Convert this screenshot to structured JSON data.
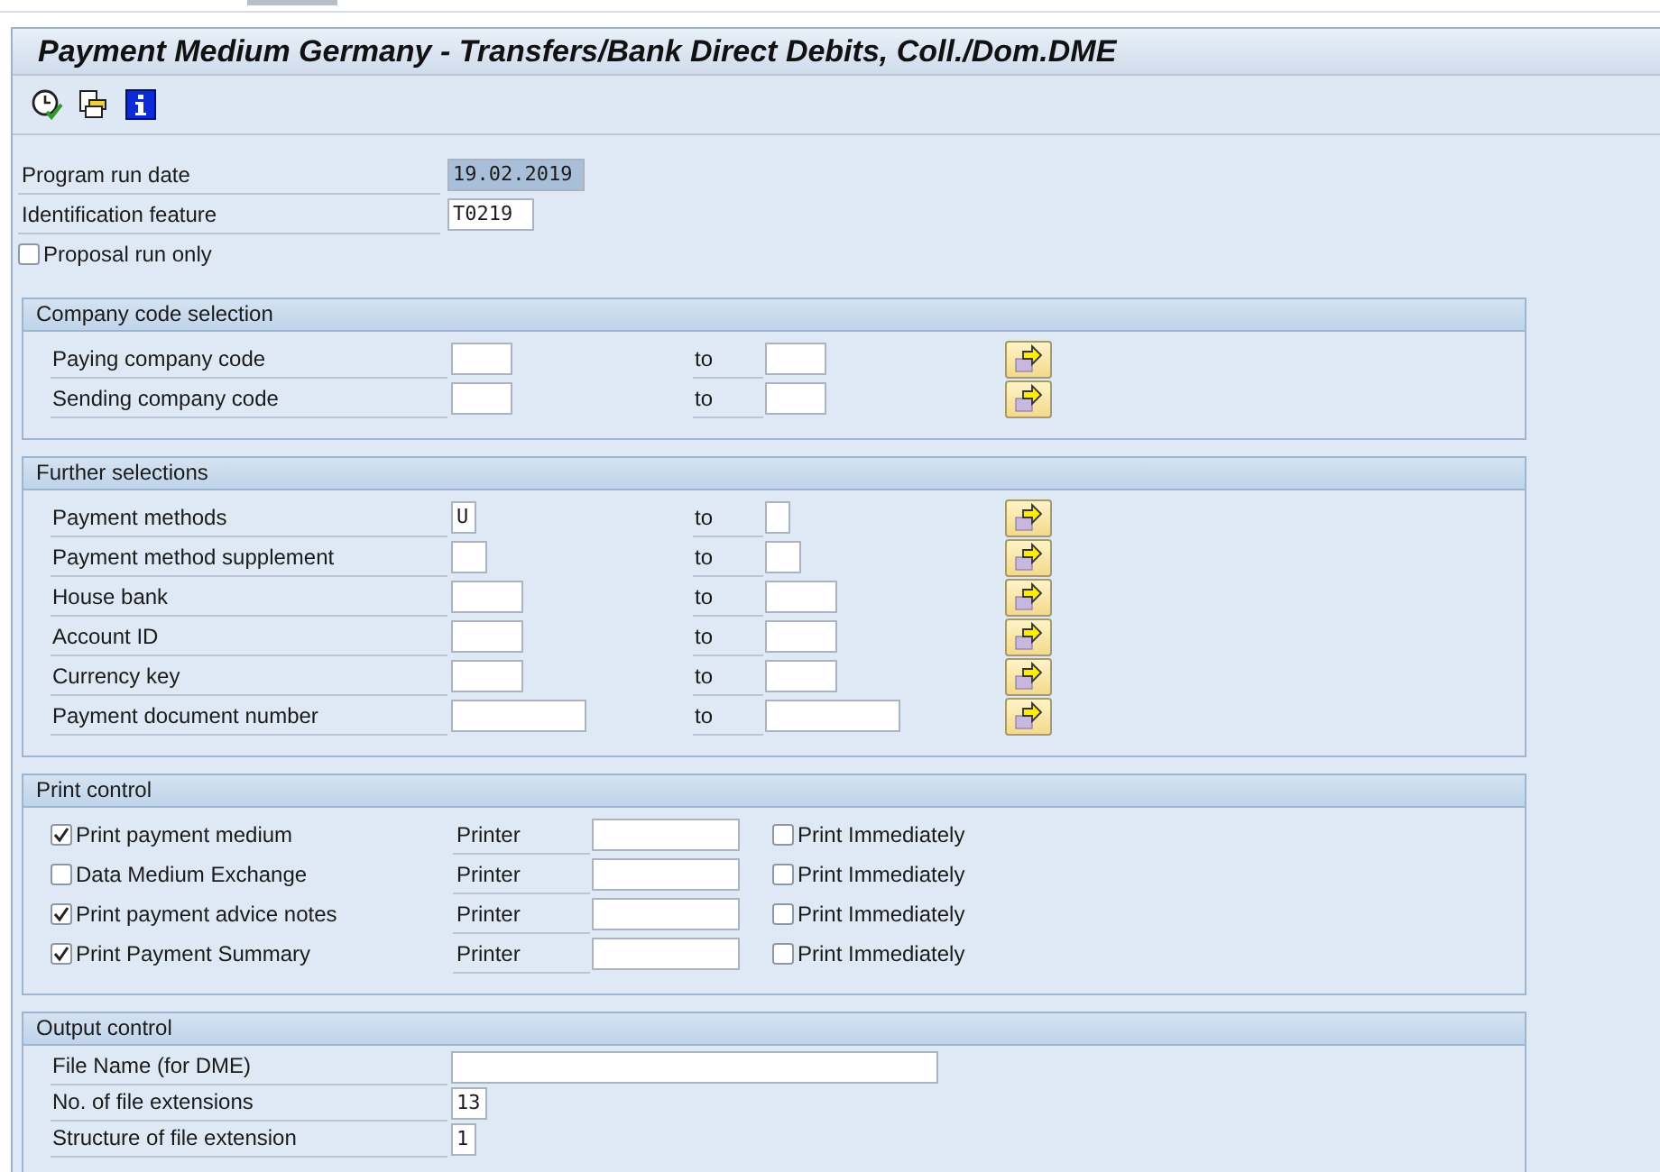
{
  "window": {
    "title": "Payment Medium Germany - Transfers/Bank Direct Debits, Coll./Dom.DME"
  },
  "header_fields": [
    {
      "label": "Program run date",
      "value": "19.02.2019",
      "selected": true
    },
    {
      "label": "Identification feature",
      "value": "T0219",
      "selected": false
    }
  ],
  "proposal_run": {
    "label": "Proposal run only",
    "checked": false
  },
  "groups": [
    {
      "title": "Company code selection",
      "kind": "range",
      "rows": [
        {
          "label": "Paying company code",
          "to": "to"
        },
        {
          "label": "Sending company code",
          "to": "to"
        }
      ]
    },
    {
      "title": "Further selections",
      "kind": "range",
      "rows": [
        {
          "label": "Payment methods",
          "low": "U",
          "to": "to"
        },
        {
          "label": "Payment method supplement",
          "to": "to"
        },
        {
          "label": "House bank",
          "to": "to"
        },
        {
          "label": "Account ID",
          "to": "to"
        },
        {
          "label": "Currency key",
          "to": "to"
        },
        {
          "label": "Payment document number",
          "to": "to"
        }
      ]
    },
    {
      "title": "Print control",
      "kind": "print",
      "rows": [
        {
          "label": "Print payment medium",
          "checked": true,
          "device": "Printer",
          "immediate": {
            "label": "Print Immediately",
            "checked": false
          }
        },
        {
          "label": "Data Medium Exchange",
          "checked": false,
          "device": "Printer",
          "immediate": {
            "label": "Print Immediately",
            "checked": false
          }
        },
        {
          "label": "Print payment advice notes",
          "checked": true,
          "device": "Printer",
          "immediate": {
            "label": "Print Immediately",
            "checked": false
          }
        },
        {
          "label": "Print Payment Summary",
          "checked": true,
          "device": "Printer",
          "immediate": {
            "label": "Print Immediately",
            "checked": false
          }
        }
      ]
    },
    {
      "title": "Output control",
      "kind": "output",
      "rows": [
        {
          "label": "File Name (for DME)"
        },
        {
          "label": "No. of file extensions",
          "value": "13"
        },
        {
          "label": "Structure of file extension",
          "value": "1"
        }
      ]
    }
  ]
}
